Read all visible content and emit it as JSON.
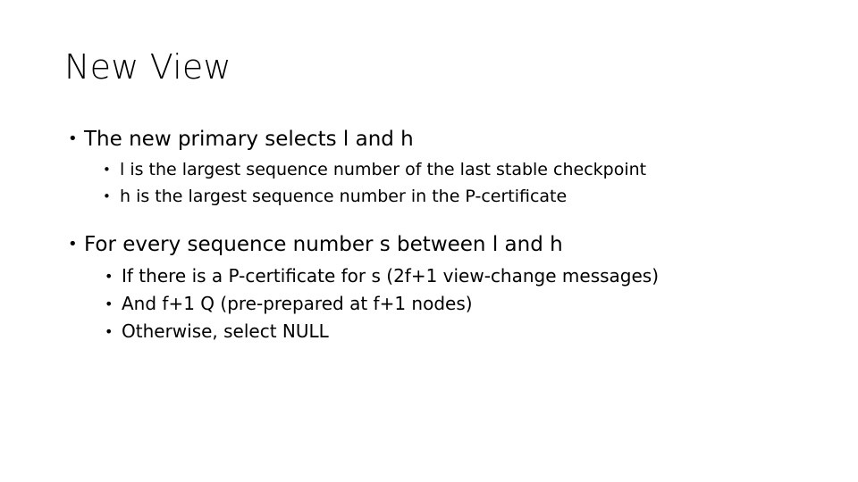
{
  "slide": {
    "title": "New View",
    "bullet_glyph": "•",
    "text_color": "#000000",
    "background_color": "#ffffff",
    "groups": [
      {
        "heading": "The new primary selects l and h",
        "sub_items": [
          "l is the largest sequence number of the last stable checkpoint",
          "h is the largest sequence number in the P-certificate"
        ]
      },
      {
        "heading": "For every sequence number s between l and h",
        "sub_items": [
          "If there is a P-certificate for s (2f+1 view-change messages)",
          "And f+1 Q (pre-prepared at f+1 nodes)",
          "Otherwise, select NULL"
        ]
      }
    ]
  }
}
